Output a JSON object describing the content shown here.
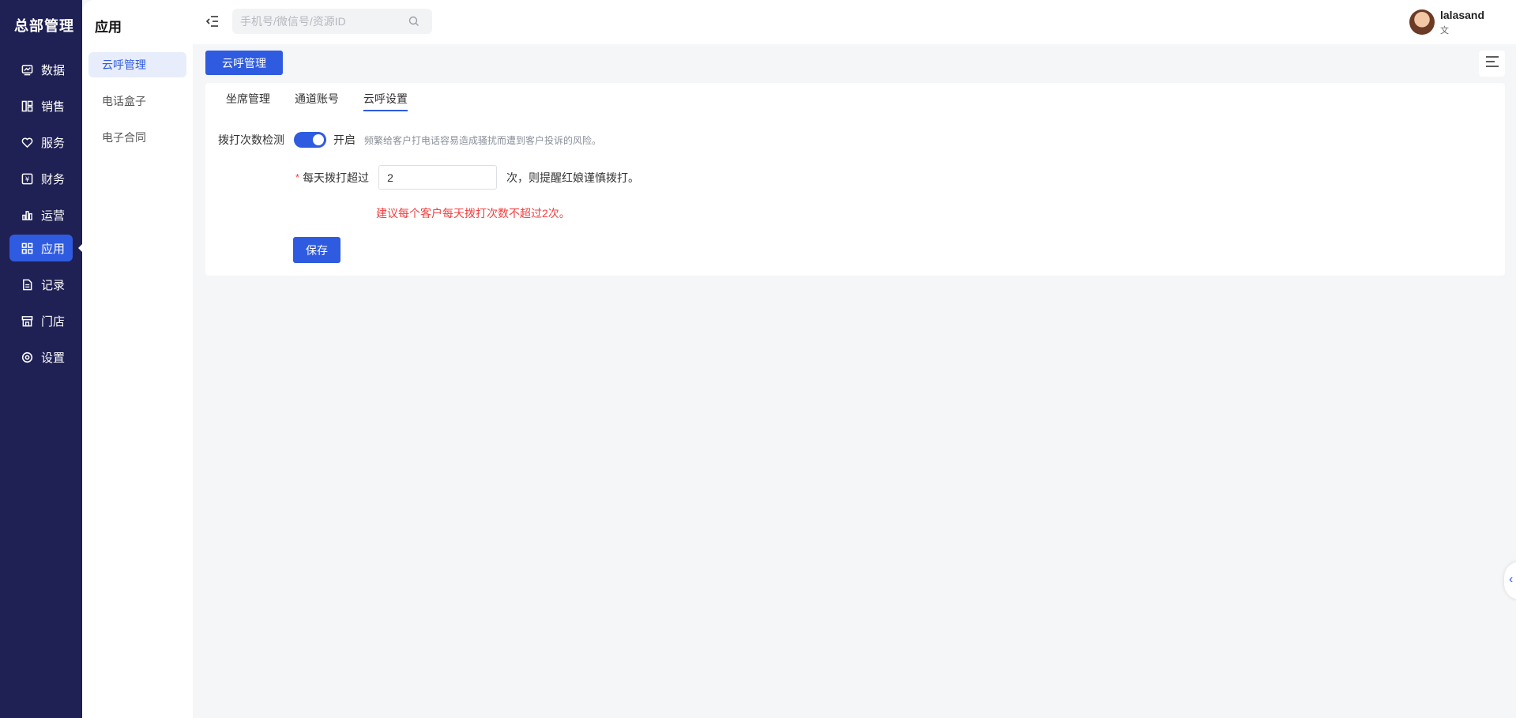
{
  "nav": {
    "brand": "总部管理",
    "items": [
      {
        "label": "数据",
        "icon": "chart-icon"
      },
      {
        "label": "销售",
        "icon": "layout-icon"
      },
      {
        "label": "服务",
        "icon": "heart-icon"
      },
      {
        "label": "财务",
        "icon": "yen-icon"
      },
      {
        "label": "运营",
        "icon": "bar-chart-icon"
      },
      {
        "label": "应用",
        "icon": "apps-icon",
        "active": true
      },
      {
        "label": "记录",
        "icon": "document-icon"
      },
      {
        "label": "门店",
        "icon": "store-icon"
      },
      {
        "label": "设置",
        "icon": "settings-icon"
      }
    ]
  },
  "subnav": {
    "title": "应用",
    "items": [
      {
        "label": "云呼管理",
        "active": true
      },
      {
        "label": "电话盒子"
      },
      {
        "label": "电子合同"
      }
    ]
  },
  "header": {
    "search_placeholder": "手机号/微信号/资源ID",
    "user_name": "lalasand",
    "user_sub": "文"
  },
  "page_tag": "云呼管理",
  "tabs": [
    {
      "label": "坐席管理"
    },
    {
      "label": "通道账号"
    },
    {
      "label": "云呼设置",
      "active": true
    }
  ],
  "form": {
    "check_label": "拨打次数检测",
    "switch_state": "开启",
    "switch_on": true,
    "hint": "频繁给客户打电话容易造成骚扰而遭到客户投诉的风险。",
    "required_mark": "*",
    "limit_label": "每天拨打超过",
    "limit_value": "2",
    "limit_suffix": "次，则提醒红娘谨慎拨打。",
    "warning": "建议每个客户每天拨打次数不超过2次。",
    "save_label": "保存"
  },
  "colors": {
    "nav_bg": "#1f2054",
    "accent": "#2f5be0",
    "warning": "#f04040"
  }
}
